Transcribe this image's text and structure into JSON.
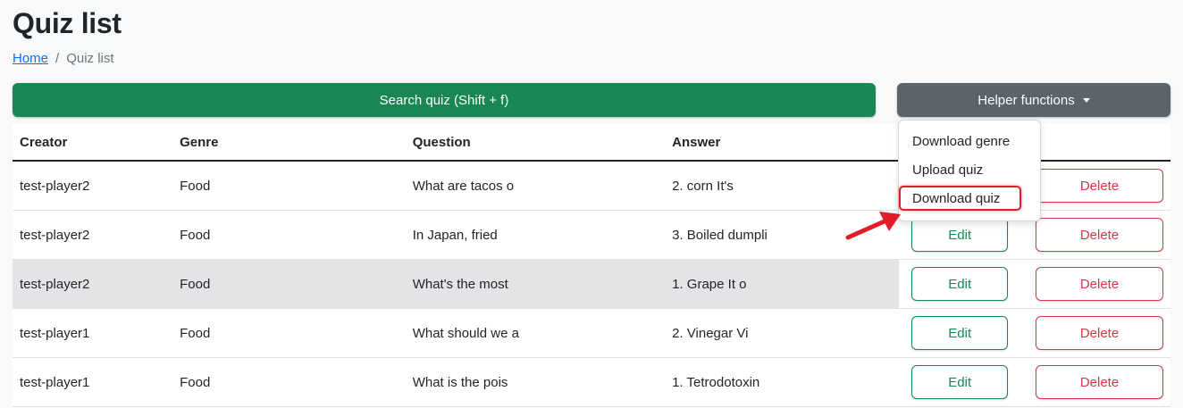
{
  "page": {
    "title": "Quiz list"
  },
  "breadcrumb": {
    "home": "Home",
    "separator": "/",
    "current": "Quiz list"
  },
  "buttons": {
    "search": "Search quiz (Shift + f)",
    "helper": "Helper functions"
  },
  "dropdown": {
    "items": [
      "Download genre",
      "Upload quiz",
      "Download quiz"
    ],
    "highlighted_index": 2
  },
  "table": {
    "headers": [
      "Creator",
      "Genre",
      "Question",
      "Answer"
    ],
    "edit_label": "Edit",
    "delete_label": "Delete",
    "rows": [
      {
        "creator": "test-player2",
        "genre": "Food",
        "question": "What are tacos o",
        "answer": "2. corn It's"
      },
      {
        "creator": "test-player2",
        "genre": "Food",
        "question": "In Japan, fried",
        "answer": "3. Boiled dumpli"
      },
      {
        "creator": "test-player2",
        "genre": "Food",
        "question": "What's the most",
        "answer": "1. Grape It o"
      },
      {
        "creator": "test-player1",
        "genre": "Food",
        "question": "What should we a",
        "answer": "2. Vinegar Vi"
      },
      {
        "creator": "test-player1",
        "genre": "Food",
        "question": "What is the pois",
        "answer": "1. Tetrodotoxin"
      }
    ],
    "hovered_row_index": 2
  },
  "colors": {
    "primary_green": "#198754",
    "secondary_gray": "#5c636a",
    "danger_red": "#dc3545",
    "link_blue": "#0d6efd",
    "annotation_red": "#e11d2a"
  },
  "icons": {
    "caret": "caret-down-icon",
    "annotation_arrow": "arrow-icon"
  }
}
